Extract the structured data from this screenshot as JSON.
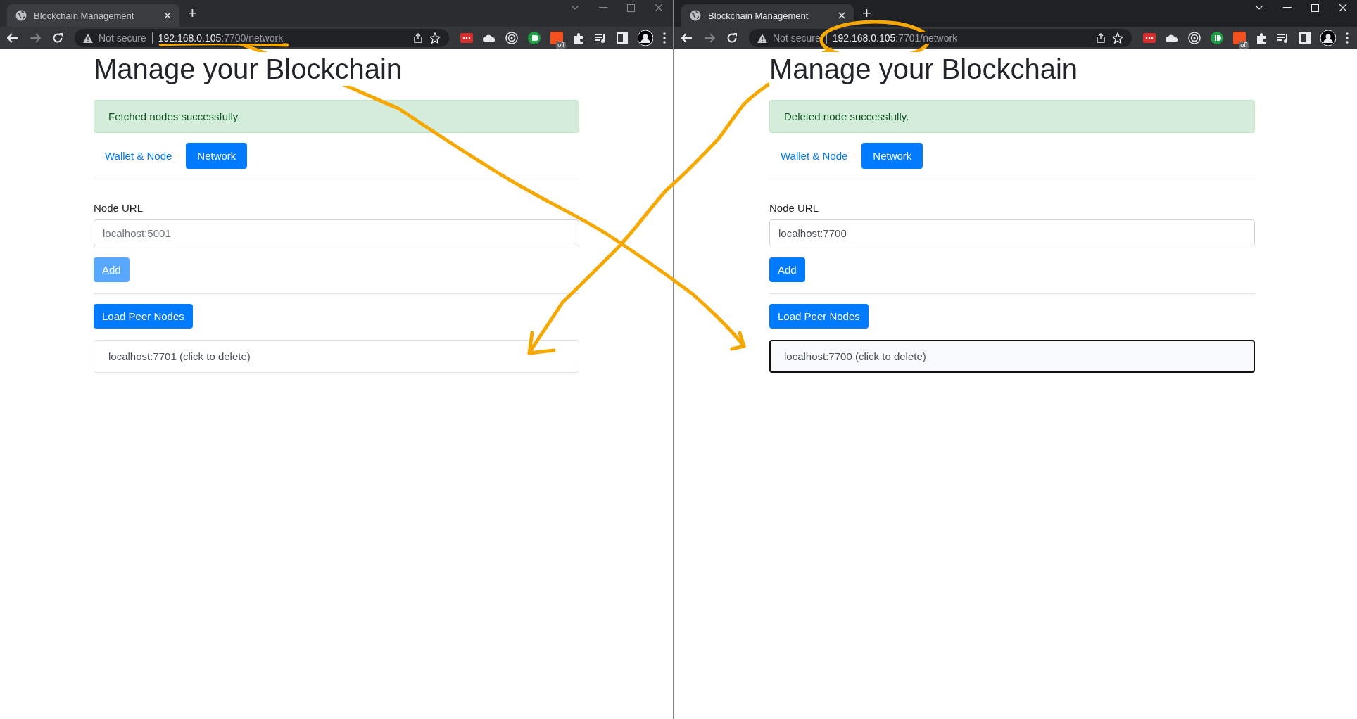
{
  "windows": [
    {
      "active": false,
      "tab_title": "Blockchain Management",
      "new_tab": "+",
      "address": {
        "security": "Not secure",
        "host": "192.168.0.105",
        "rest": ":7700/network"
      },
      "extension_badge": "off",
      "page": {
        "heading": "Manage your Blockchain",
        "alert": "Fetched nodes successfully.",
        "tabs": [
          {
            "label": "Wallet & Node",
            "selected": false
          },
          {
            "label": "Network",
            "selected": true
          }
        ],
        "field_label": "Node URL",
        "input": {
          "placeholder": "localhost:5001"
        },
        "add": {
          "label": "Add",
          "disabled": true
        },
        "load_label": "Load Peer Nodes",
        "nodes": [
          {
            "label": "localhost:7701 (click to delete)",
            "focused": false
          }
        ]
      }
    },
    {
      "active": true,
      "tab_title": "Blockchain Management",
      "new_tab": "+",
      "address": {
        "security": "Not secure",
        "host": "192.168.0.105",
        "rest": ":7701/network"
      },
      "extension_badge": "off",
      "page": {
        "heading": "Manage your Blockchain",
        "alert": "Deleted node successfully.",
        "tabs": [
          {
            "label": "Wallet & Node",
            "selected": false
          },
          {
            "label": "Network",
            "selected": true
          }
        ],
        "field_label": "Node URL",
        "input": {
          "value": "localhost:7700"
        },
        "add": {
          "label": "Add",
          "disabled": false
        },
        "load_label": "Load Peer Nodes",
        "nodes": [
          {
            "label": "localhost:7700 (click to delete)",
            "focused": true
          }
        ]
      }
    }
  ]
}
